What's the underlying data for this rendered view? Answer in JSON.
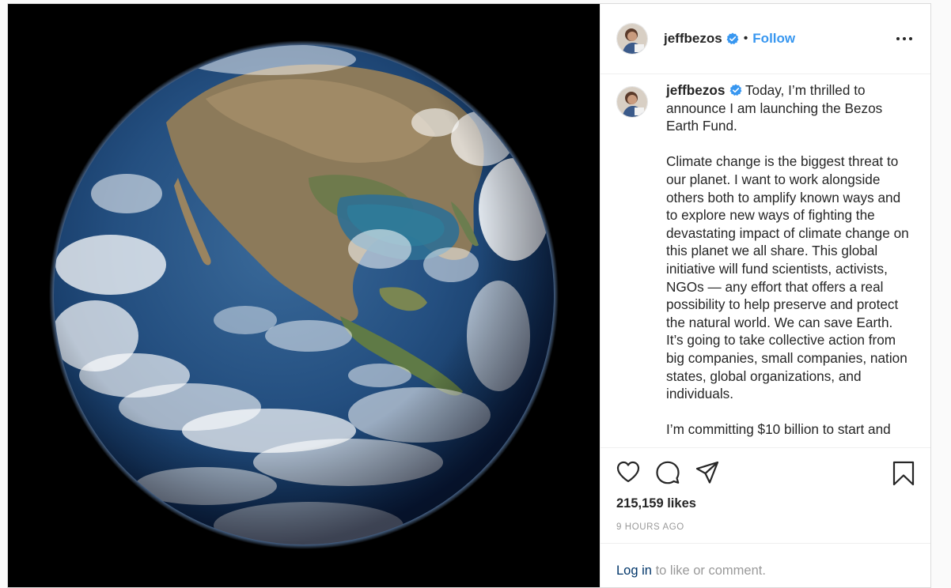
{
  "post": {
    "username": "jeffbezos",
    "follow_label": "Follow",
    "separator": "•",
    "caption": {
      "username": "jeffbezos",
      "paragraphs": [
        "Today, I’m thrilled to announce I am launching the Bezos Earth Fund.",
        "Climate change is the biggest threat to our planet. I want to work alongside others both to amplify known ways and to explore new ways of fighting the devastating impact of climate change on this planet we all share. This global initiative will fund scientists, activists, NGOs — any effort that offers a real possibility to help preserve and protect the natural world. We can save Earth. It’s going to take collective action from big companies, small companies, nation states, global organizations, and individuals.",
        "I’m committing $10 billion to start and"
      ]
    },
    "likes": "215,159 likes",
    "timestamp": "9 HOURS AGO",
    "login": {
      "link": "Log in",
      "rest": "to like or comment."
    }
  },
  "icons": {
    "verified": "verified-badge-icon",
    "more": "more-options-icon",
    "like": "heart-icon",
    "comment": "comment-bubble-icon",
    "share": "send-paper-plane-icon",
    "save": "bookmark-icon"
  },
  "colors": {
    "follow_blue": "#3897f0",
    "verified_blue": "#3897f0",
    "link_dark_blue": "#003569",
    "muted_gray": "#999999",
    "text": "#262626"
  }
}
